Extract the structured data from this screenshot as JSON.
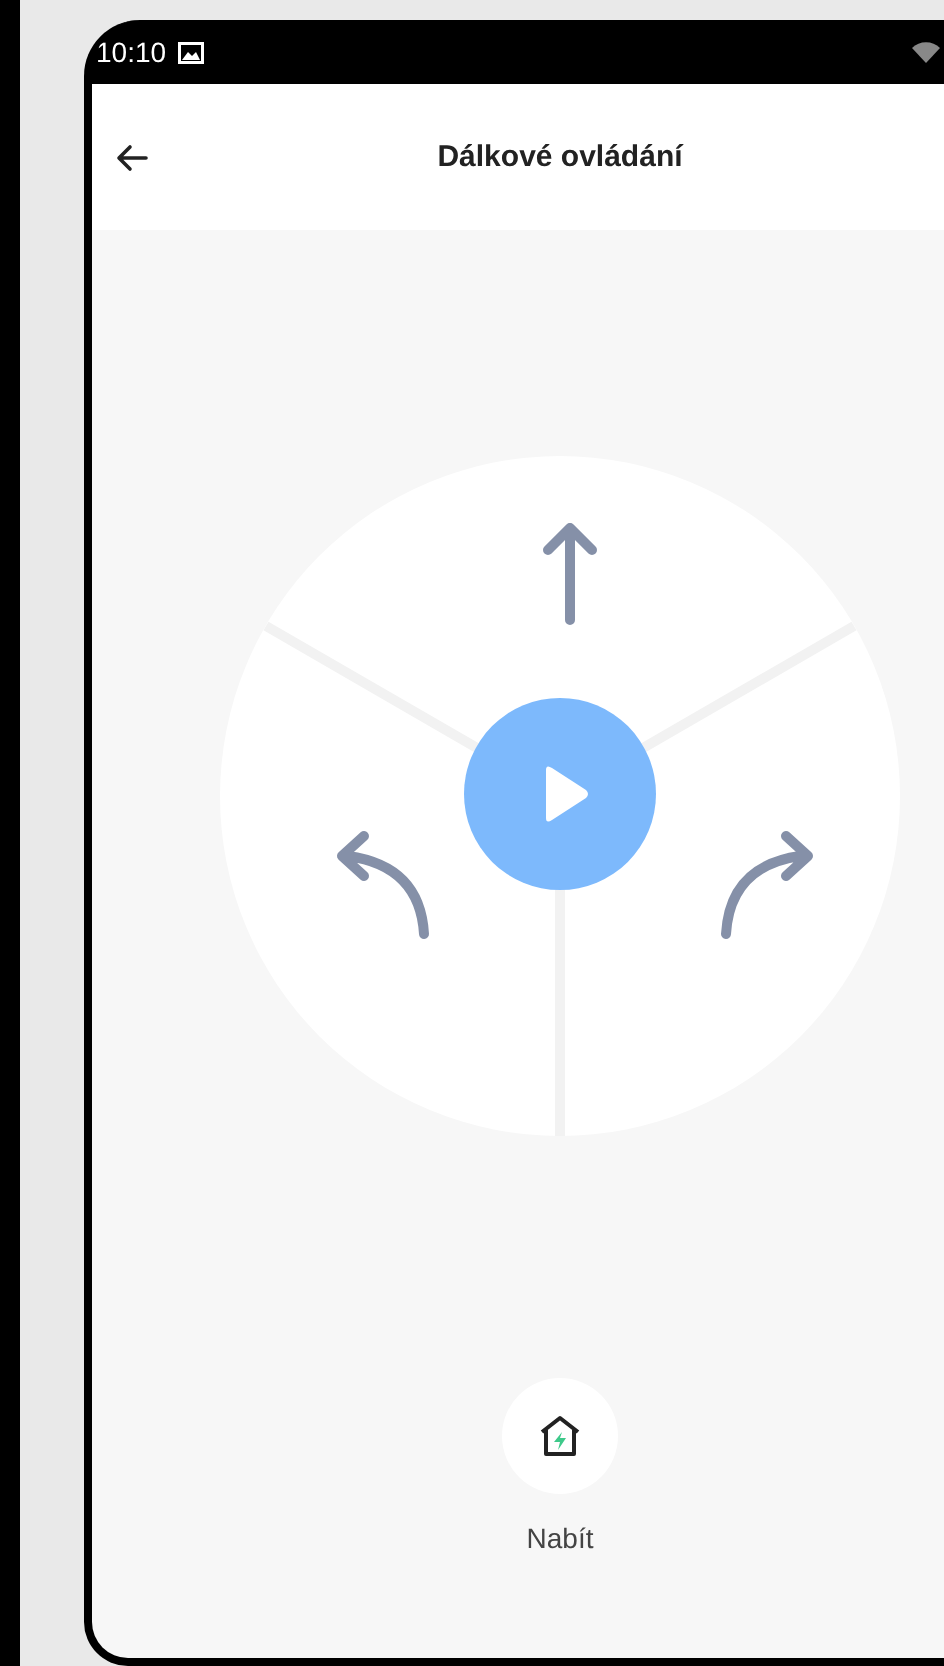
{
  "status_bar": {
    "time": "10:10"
  },
  "header": {
    "title": "Dálkové ovládání"
  },
  "charge_button": {
    "label": "Nabít"
  }
}
